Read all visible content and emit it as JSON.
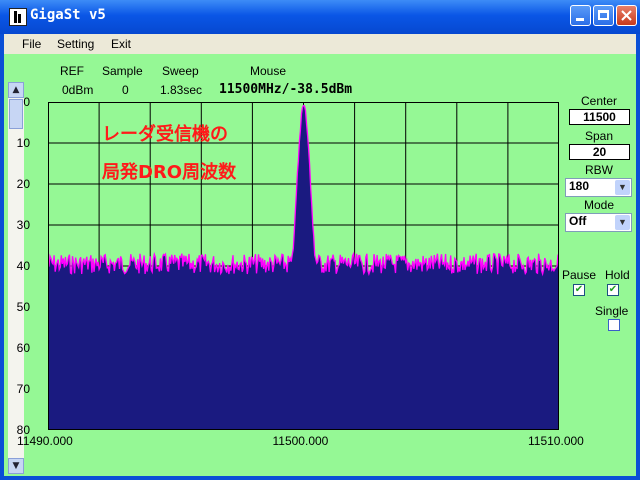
{
  "window": {
    "title": "GigaSt v5"
  },
  "menu": {
    "items": [
      "File",
      "Setting",
      "Exit"
    ]
  },
  "status": {
    "headers": {
      "ref": "REF",
      "sample": "Sample",
      "sweep": "Sweep",
      "mouse": "Mouse"
    },
    "values": {
      "ref": "0dBm",
      "sample": "0",
      "sweep": "1.83sec",
      "mouse": "11500MHz/-38.5dBm"
    }
  },
  "annotation": {
    "line1": "レーダ受信機の",
    "line2": "局発DRO周波数"
  },
  "controls": {
    "center_label": "Center",
    "center_value": "11500",
    "span_label": "Span",
    "span_value": "20",
    "rbw_label": "RBW",
    "rbw_value": "180",
    "mode_label": "Mode",
    "mode_value": "Off",
    "pause_label": "Pause",
    "hold_label": "Hold",
    "single_label": "Single",
    "pause_checked": true,
    "hold_checked": true,
    "single_checked": false
  },
  "colors": {
    "fill": "#1a1a80",
    "trace": "#ff00ff",
    "grid": "#000000",
    "background": "#95f895"
  },
  "chart_data": {
    "type": "area",
    "x_tick_labels": [
      "11490.000",
      "11500.000",
      "11510.000"
    ],
    "y_tick_labels": [
      "0",
      "10",
      "20",
      "30",
      "40",
      "50",
      "60",
      "70",
      "80"
    ],
    "xlim": [
      11490,
      11510
    ],
    "ylim": [
      0,
      80
    ],
    "y_inverted": true,
    "noise_floor": 39.5,
    "noise_amplitude": 2.5,
    "peak": {
      "x": 11500,
      "y": 0
    },
    "peak_profile": [
      {
        "x": 11499.55,
        "y": 39
      },
      {
        "x": 11499.65,
        "y": 30
      },
      {
        "x": 11499.75,
        "y": 18
      },
      {
        "x": 11499.85,
        "y": 8
      },
      {
        "x": 11499.93,
        "y": 2
      },
      {
        "x": 11500.0,
        "y": 0
      },
      {
        "x": 11500.07,
        "y": 1
      },
      {
        "x": 11500.15,
        "y": 6
      },
      {
        "x": 11500.25,
        "y": 16
      },
      {
        "x": 11500.35,
        "y": 28
      },
      {
        "x": 11500.45,
        "y": 37
      },
      {
        "x": 11500.55,
        "y": 39
      }
    ],
    "grid": true
  }
}
